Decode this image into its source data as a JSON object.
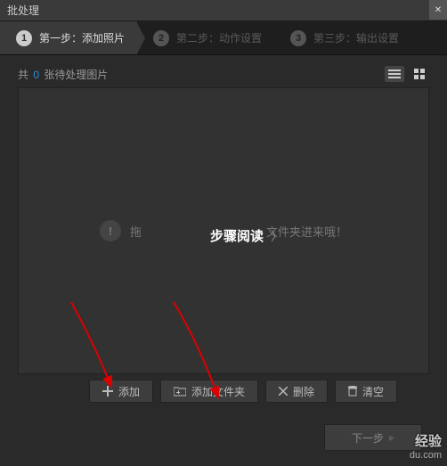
{
  "window": {
    "title": "批处理"
  },
  "steps": {
    "s1": {
      "num": "1",
      "label": "第一步：添加照片"
    },
    "s2": {
      "num": "2",
      "label": "第二步：动作设置"
    },
    "s3": {
      "num": "3",
      "label": "第三步：输出设置"
    }
  },
  "counter": {
    "prefix": "共",
    "count": "0",
    "suffix": "张待处理图片"
  },
  "hint": {
    "mark": "!",
    "text_left": "拖",
    "text_right": "文件夹进来哦！"
  },
  "buttons": {
    "add": "添加",
    "add_folder": "添加文件夹",
    "delete": "删除",
    "clear": "清空",
    "next": "下一步"
  },
  "overlay": {
    "label": "步骤阅读",
    "chev": "〉"
  },
  "watermark": {
    "line1": "经验",
    "line2": "du.com"
  }
}
